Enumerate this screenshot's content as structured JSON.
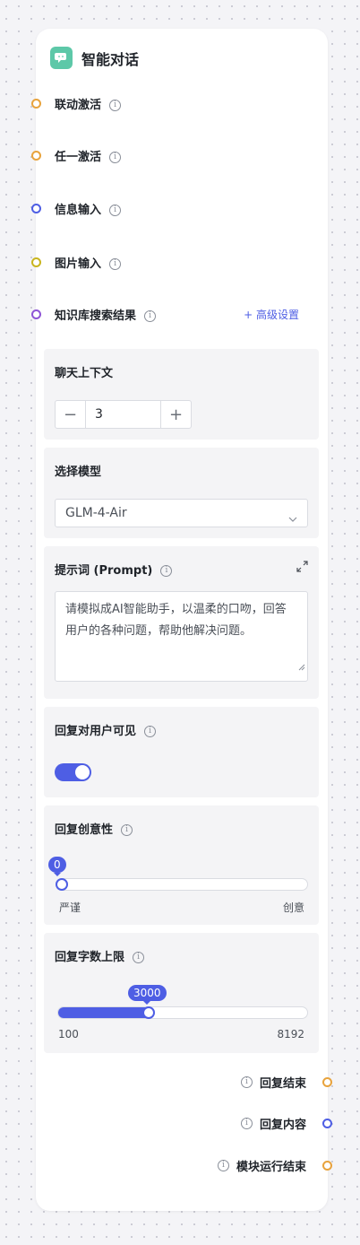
{
  "node": {
    "title": "智能对话",
    "icon": "chat-bubble-icon",
    "accent": "#4e5ee4"
  },
  "inputs": [
    {
      "label": "联动激活",
      "color": "#e8a33d"
    },
    {
      "label": "任一激活",
      "color": "#e8a33d"
    },
    {
      "label": "信息输入",
      "color": "#4e5ee4"
    },
    {
      "label": "图片输入",
      "color": "#c9b51f"
    },
    {
      "label": "知识库搜索结果",
      "color": "#8e55d6"
    }
  ],
  "advanced_settings_label": "+ 高级设置",
  "chat_context": {
    "title": "聊天上下文",
    "value": "3",
    "minus": "−",
    "plus": "+"
  },
  "model": {
    "title": "选择模型",
    "selected": "GLM-4-Air"
  },
  "prompt": {
    "title": "提示词 (Prompt)",
    "value": "请模拟成AI智能助手，以温柔的口吻，回答用户的各种问题，帮助他解决问题。"
  },
  "visible_to_user": {
    "title": "回复对用户可见",
    "enabled": true
  },
  "creativity": {
    "title": "回复创意性",
    "value": "0",
    "fraction": 0.0,
    "min_label": "严谨",
    "max_label": "创意"
  },
  "max_chars": {
    "title": "回复字数上限",
    "value": "3000",
    "min": "100",
    "max": "8192",
    "fraction": 0.36
  },
  "outputs": [
    {
      "label": "回复结束",
      "color": "#e8a33d"
    },
    {
      "label": "回复内容",
      "color": "#4e5ee4"
    },
    {
      "label": "模块运行结束",
      "color": "#e8a33d"
    }
  ]
}
